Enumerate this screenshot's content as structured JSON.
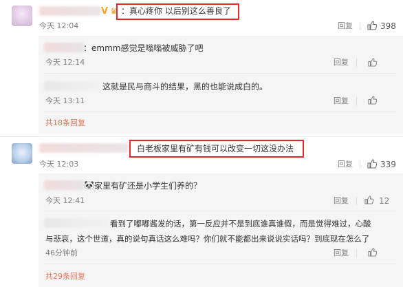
{
  "comments": [
    {
      "text": "：真心疼你 以后别这么善良了",
      "time": "今天 12:04",
      "reply_label": "回复",
      "likes": "398",
      "replies": [
        {
          "text": "：emmm感觉是嗡嗡被威胁了吧",
          "time": "今天 12:14",
          "reply_label": "回复",
          "likes": ""
        },
        {
          "text": "这就是民与商斗的结果，黑的也能说成白的。",
          "time": "今天 13:11",
          "reply_label": "回复",
          "likes": ""
        }
      ],
      "more_label": "共18条回复"
    },
    {
      "text": "白老板家里有矿有钱可以改变一切这没办法",
      "time": "今天 12:03",
      "reply_label": "回复",
      "likes": "339",
      "replies": [
        {
          "text": "家里有矿还是小学生们养的？",
          "time": "今天 12:41",
          "reply_label": "回复",
          "likes": "12"
        },
        {
          "text_line1": "看到了嘟嘟酱发的话，第一反应并不是到底谁真谁假，而是觉得难过，心酸",
          "text_line2": "与悲哀，这个世道，真的说句真话这么难吗？你们就不能都出来说说实话吗？到底现在怎么了",
          "time": "46分钟前",
          "reply_label": "回复",
          "likes": ""
        }
      ],
      "more_label": "共29条回复"
    }
  ]
}
